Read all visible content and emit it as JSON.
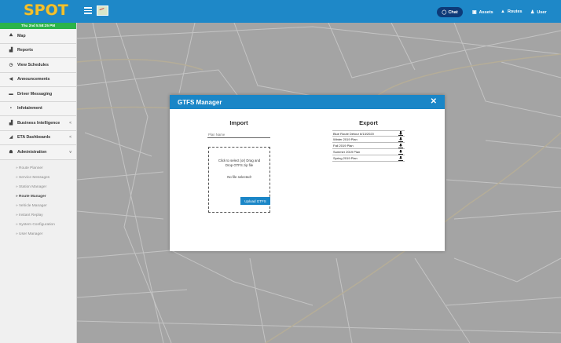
{
  "app": {
    "logo_text": "SPOT",
    "datetime": "Thu 2nd 5:58:25 PM"
  },
  "topbar": {
    "menu_icon": "hamburger-icon",
    "map_icon": "map-thumbnail-icon",
    "chat_label": "Chat",
    "nav": [
      {
        "label": "Assets",
        "icon": "assets-icon"
      },
      {
        "label": "Routes",
        "icon": "routes-icon"
      },
      {
        "label": "User",
        "icon": "user-icon"
      }
    ]
  },
  "sidebar": {
    "items": [
      {
        "label": "Map",
        "icon": "map-icon",
        "glyph": "⛰"
      },
      {
        "label": "Reports",
        "icon": "reports-icon",
        "glyph": "▟"
      },
      {
        "label": "View Schedules",
        "icon": "clock-icon",
        "glyph": "◷"
      },
      {
        "label": "Announcements",
        "icon": "megaphone-icon",
        "glyph": "◀"
      },
      {
        "label": "Driver Messaging",
        "icon": "message-icon",
        "glyph": "▬"
      },
      {
        "label": "Infotainment",
        "icon": "video-icon",
        "glyph": "▪"
      },
      {
        "label": "Business Intelligence",
        "icon": "chart-icon",
        "glyph": "▟",
        "chevron": "<"
      },
      {
        "label": "ETA Dashboards",
        "icon": "dashboard-icon",
        "glyph": "◢",
        "chevron": "<"
      },
      {
        "label": "Administration",
        "icon": "users-icon",
        "glyph": "☗",
        "chevron": "v"
      }
    ],
    "submenu": [
      {
        "label": "» Route Planner"
      },
      {
        "label": "» Service Messages"
      },
      {
        "label": "» Station Manager"
      },
      {
        "label": "» Route Manager",
        "active": true
      },
      {
        "label": "» Vehicle Manager"
      },
      {
        "label": "» Instant Replay"
      },
      {
        "label": "» System Configuration"
      },
      {
        "label": "» User Manager"
      }
    ]
  },
  "modal": {
    "title": "GTFS Manager",
    "close_glyph": "✕",
    "import": {
      "title": "Import",
      "plan_placeholder": "Plan Name",
      "drop_instructions": "Click to select (or) Drag and Drop GTFS zip file",
      "drop_status": "No file selected!",
      "upload_label": "Upload GTFS"
    },
    "export": {
      "title": "Export",
      "plans": [
        "Blue Route Detour 6/13/2020",
        "Winter 2019 Plan",
        "Fall 2019 Plan",
        "Summer 2019 Plan",
        "Spring 2019 Plan"
      ]
    }
  },
  "colors": {
    "primary": "#1e88c8",
    "logo": "#f2c12e",
    "datebar": "#2bb34a",
    "chat": "#0d3a78"
  }
}
